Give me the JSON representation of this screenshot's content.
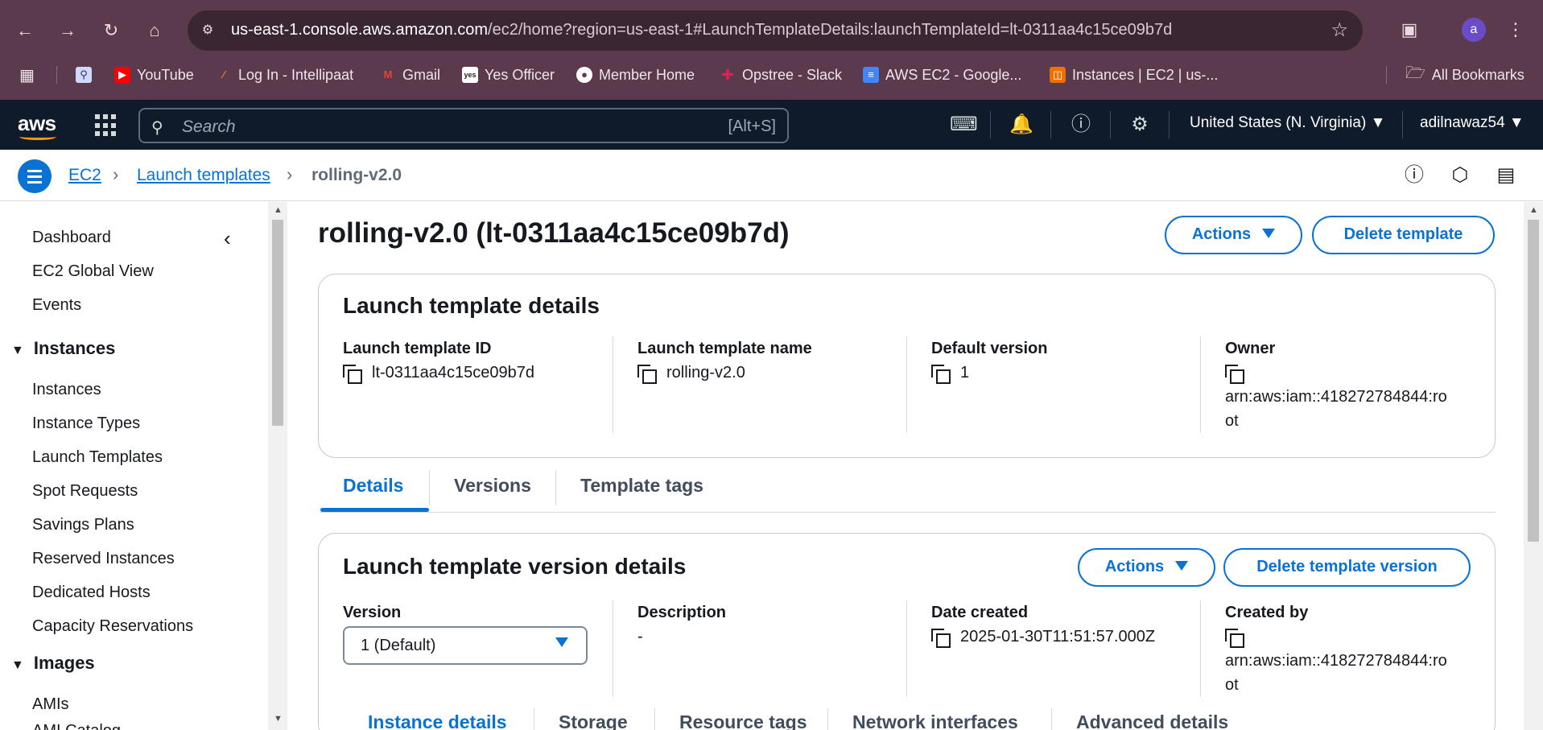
{
  "browser": {
    "url_host": "us-east-1.console.aws.amazon.com",
    "url_path": "/ec2/home?region=us-east-1#LaunchTemplateDetails:launchTemplateId=lt-0311aa4c15ce09b7d",
    "avatar_letter": "a",
    "bookmarks": [
      {
        "label": "YouTube",
        "icon": "youtube-icon",
        "color": "#ff0000"
      },
      {
        "label": "Log In - Intellipaat",
        "icon": "intellipaat-icon",
        "color": "#f47b20"
      },
      {
        "label": "Gmail",
        "icon": "gmail-icon",
        "color": "#ea4335"
      },
      {
        "label": "Yes Officer",
        "icon": "yesofficer-icon",
        "color": "#ffffff"
      },
      {
        "label": "Member Home",
        "icon": "globe-icon",
        "color": "#dddddd"
      },
      {
        "label": "Opstree - Slack",
        "icon": "slack-icon",
        "color": "#e01e5a"
      },
      {
        "label": "AWS EC2 - Google...",
        "icon": "google-docs-icon",
        "color": "#4285f4"
      },
      {
        "label": "Instances | EC2 | us-...",
        "icon": "aws-instances-icon",
        "color": "#ed7100"
      }
    ],
    "all_bookmarks": "All Bookmarks"
  },
  "aws_nav": {
    "logo": "aws",
    "search_placeholder": "Search",
    "search_shortcut": "[Alt+S]",
    "region": "United States (N. Virginia)",
    "user": "adilnawaz54"
  },
  "breadcrumb": {
    "items": [
      "EC2",
      "Launch templates"
    ],
    "current": "rolling-v2.0"
  },
  "sidebar": {
    "top_links": [
      "Dashboard",
      "EC2 Global View",
      "Events"
    ],
    "instances_header": "Instances",
    "instances_links": [
      "Instances",
      "Instance Types",
      "Launch Templates",
      "Spot Requests",
      "Savings Plans",
      "Reserved Instances",
      "Dedicated Hosts",
      "Capacity Reservations"
    ],
    "images_header": "Images",
    "images_links": [
      "AMIs",
      "AMI Catalog"
    ]
  },
  "page": {
    "title": "rolling-v2.0 (lt-0311aa4c15ce09b7d)",
    "actions_label": "Actions",
    "delete_label": "Delete template"
  },
  "details_card": {
    "title": "Launch template details",
    "fields": [
      {
        "label": "Launch template ID",
        "value": "lt-0311aa4c15ce09b7d"
      },
      {
        "label": "Launch template name",
        "value": "rolling-v2.0"
      },
      {
        "label": "Default version",
        "value": "1"
      },
      {
        "label": "Owner",
        "value_line1": "arn:aws:iam::418272784844:ro",
        "value_line2": "ot"
      }
    ]
  },
  "tabs": [
    "Details",
    "Versions",
    "Template tags"
  ],
  "version_card": {
    "title": "Launch template version details",
    "actions_label": "Actions",
    "delete_label": "Delete template version",
    "version_label": "Version",
    "version_value": "1 (Default)",
    "description_label": "Description",
    "description_value": "-",
    "date_label": "Date created",
    "date_value": "2025-01-30T11:51:57.000Z",
    "created_by_label": "Created by",
    "created_by_line1": "arn:aws:iam::418272784844:ro",
    "created_by_line2": "ot"
  },
  "subtabs": [
    "Instance details",
    "Storage",
    "Resource tags",
    "Network interfaces",
    "Advanced details"
  ]
}
